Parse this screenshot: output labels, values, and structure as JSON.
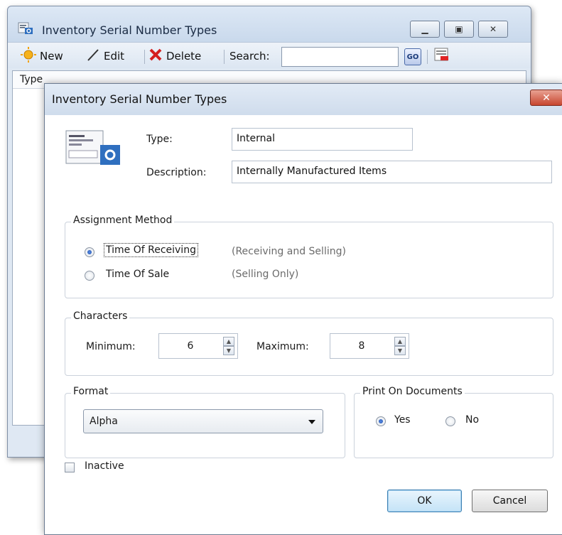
{
  "back_window": {
    "title": "Inventory Serial Number Types",
    "toolbar": {
      "new_label": "New",
      "edit_label": "Edit",
      "delete_label": "Delete",
      "search_label": "Search:",
      "search_value": "",
      "go_label": "GO"
    },
    "list": {
      "columns": [
        "Type"
      ]
    }
  },
  "dialog": {
    "title": "Inventory Serial Number Types",
    "close_label": "✕",
    "type_label": "Type:",
    "type_value": "Internal",
    "description_label": "Description:",
    "description_value": "Internally Manufactured Items",
    "assignment": {
      "title": "Assignment Method",
      "options": [
        {
          "label": "Time Of Receiving",
          "hint": "(Receiving and Selling)",
          "selected": true
        },
        {
          "label": "Time Of Sale",
          "hint": "(Selling Only)",
          "selected": false
        }
      ]
    },
    "characters": {
      "title": "Characters",
      "minimum_label": "Minimum:",
      "minimum_value": "6",
      "maximum_label": "Maximum:",
      "maximum_value": "8"
    },
    "format": {
      "title": "Format",
      "selected": "Alpha"
    },
    "print": {
      "title": "Print On Documents",
      "yes_label": "Yes",
      "no_label": "No",
      "selected": "Yes"
    },
    "inactive_label": "Inactive",
    "inactive_checked": false,
    "ok_label": "OK",
    "cancel_label": "Cancel"
  }
}
